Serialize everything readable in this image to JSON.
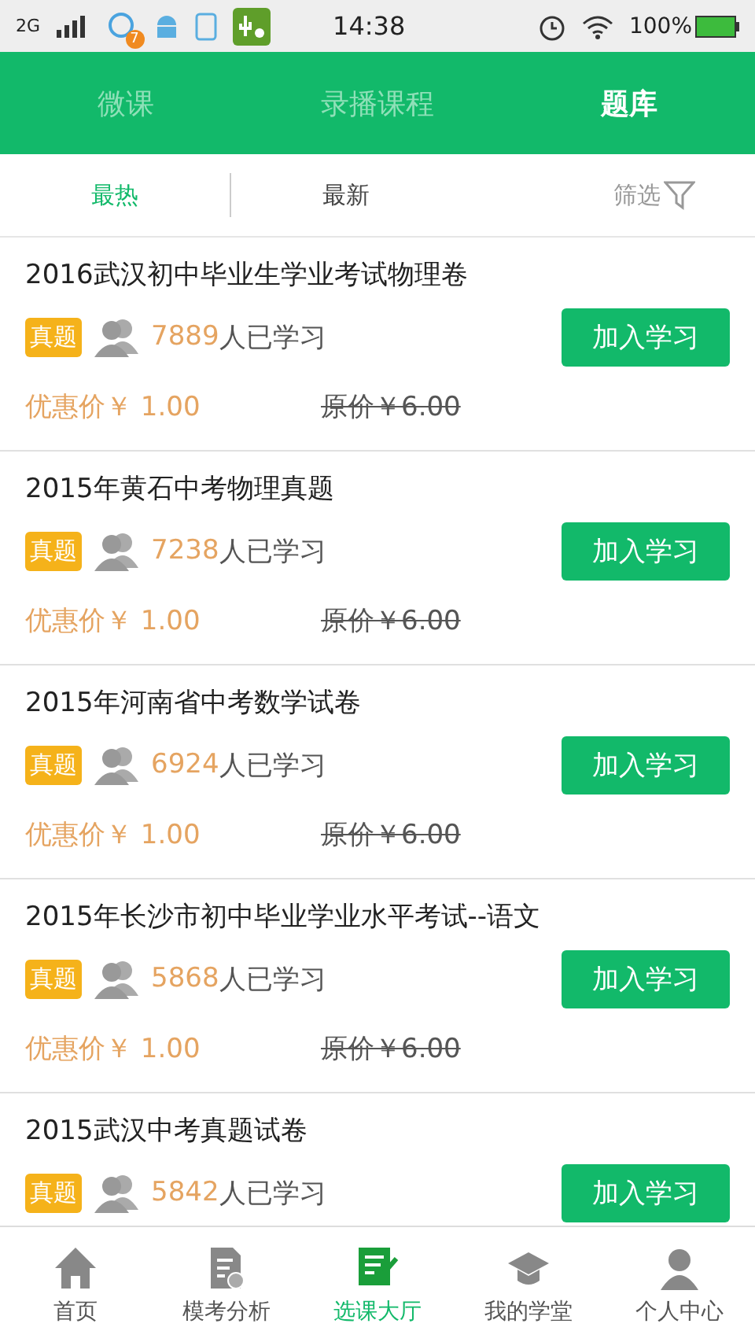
{
  "status_bar": {
    "network": "2G",
    "badge": "7",
    "time": "14:38",
    "battery": "100%"
  },
  "top_tabs": [
    {
      "label": "微课",
      "selected": false
    },
    {
      "label": "录播课程",
      "selected": false
    },
    {
      "label": "题库",
      "selected": true
    }
  ],
  "sort_tabs": [
    {
      "label": "最热",
      "selected": true
    },
    {
      "label": "最新",
      "selected": false
    }
  ],
  "filter": {
    "label": "筛选"
  },
  "items": [
    {
      "title": "2016武汉初中毕业生学业考试物理卷",
      "tag": "真题",
      "count": "7889",
      "count_suffix": "人已学习",
      "button": "加入学习",
      "price": "优惠价￥ 1.00",
      "original_price": "原价￥6.00"
    },
    {
      "title": "2015年黄石中考物理真题",
      "tag": "真题",
      "count": "7238",
      "count_suffix": "人已学习",
      "button": "加入学习",
      "price": "优惠价￥ 1.00",
      "original_price": "原价￥6.00"
    },
    {
      "title": "2015年河南省中考数学试卷",
      "tag": "真题",
      "count": "6924",
      "count_suffix": "人已学习",
      "button": "加入学习",
      "price": "优惠价￥ 1.00",
      "original_price": "原价￥6.00"
    },
    {
      "title": "2015年长沙市初中毕业学业水平考试--语文",
      "tag": "真题",
      "count": "5868",
      "count_suffix": "人已学习",
      "button": "加入学习",
      "price": "优惠价￥ 1.00",
      "original_price": "原价￥6.00"
    },
    {
      "title": "2015武汉中考真题试卷",
      "tag": "真题",
      "count": "5842",
      "count_suffix": "人已学习",
      "button": "加入学习"
    }
  ],
  "bottom_nav": [
    {
      "label": "首页",
      "kind": "home",
      "selected": false
    },
    {
      "label": "模考分析",
      "kind": "report",
      "selected": false
    },
    {
      "label": "选课大厅",
      "kind": "courses",
      "selected": true
    },
    {
      "label": "我的学堂",
      "kind": "school",
      "selected": false
    },
    {
      "label": "个人中心",
      "kind": "person",
      "selected": false
    }
  ]
}
